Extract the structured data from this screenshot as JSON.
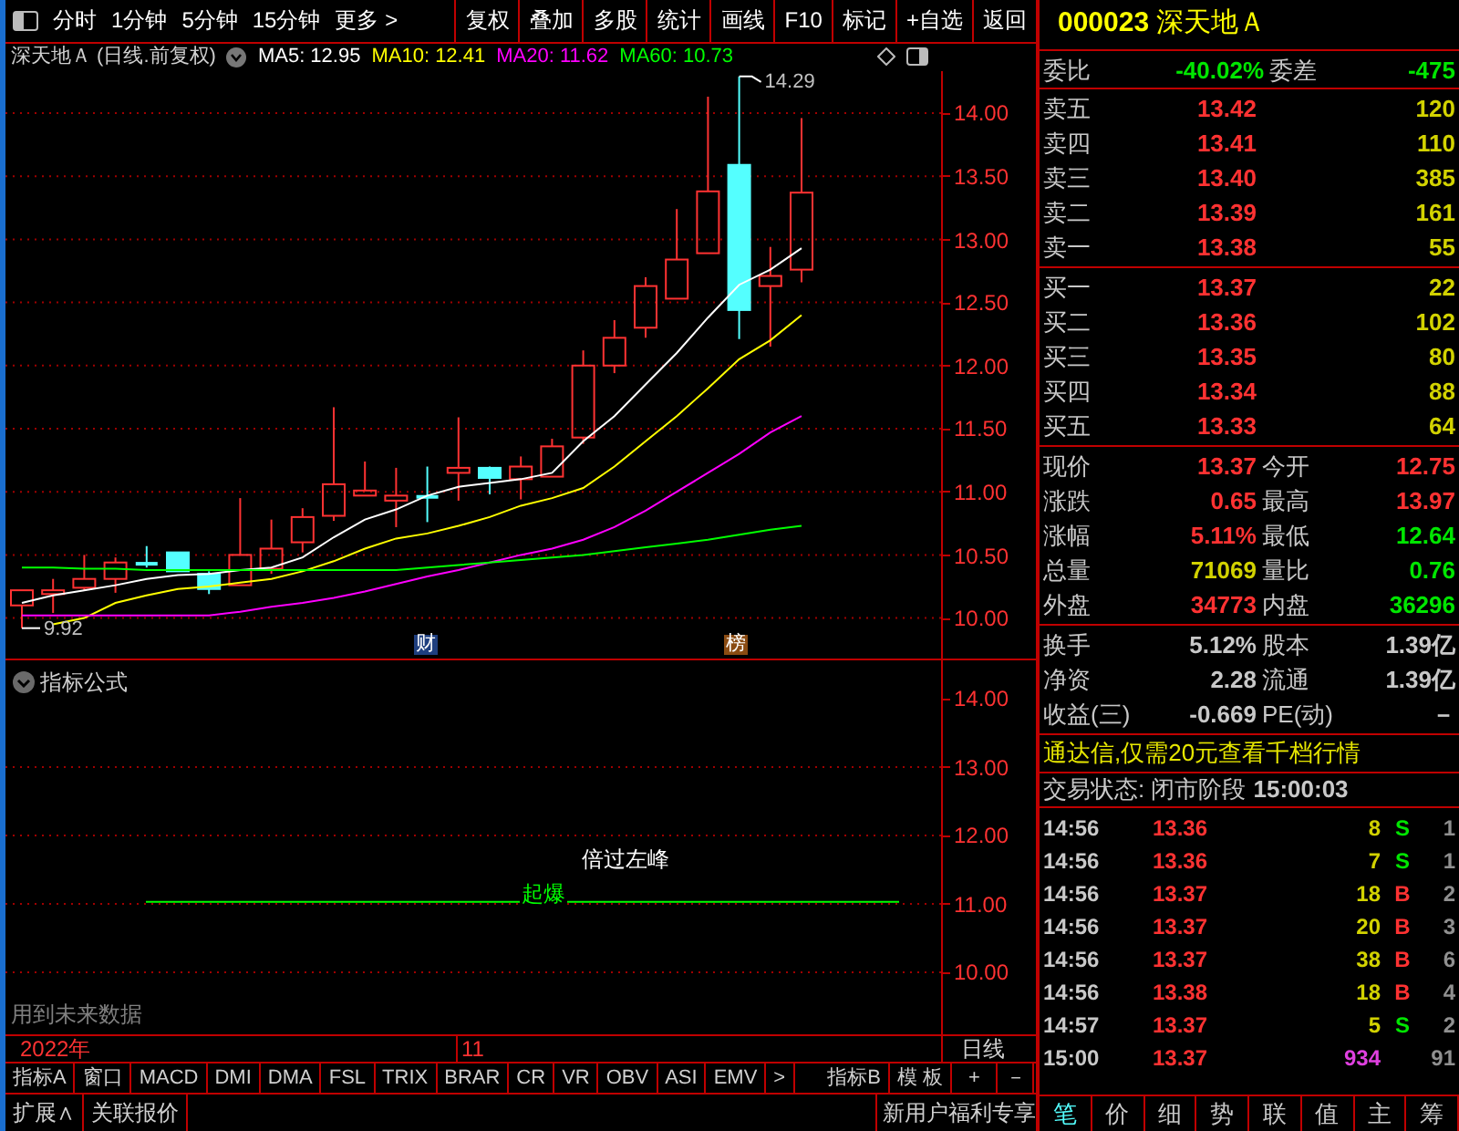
{
  "toolbar": {
    "periods": [
      "分时",
      "1分钟",
      "5分钟",
      "15分钟",
      "更多 >"
    ],
    "actions": [
      "复权",
      "叠加",
      "多股",
      "统计",
      "画线",
      "F10",
      "标记",
      "+自选",
      "返回"
    ]
  },
  "chart": {
    "title": "深天地Ａ (日线.前复权)",
    "ma": [
      {
        "label": "MA5: 12.95",
        "color": "#ffffff"
      },
      {
        "label": "MA10: 12.41",
        "color": "#ffff00"
      },
      {
        "label": "MA20: 11.62",
        "color": "#ff00ff"
      },
      {
        "label": "MA60: 10.73",
        "color": "#00ff00"
      }
    ],
    "price_axis": [
      "14.00",
      "13.50",
      "13.00",
      "12.50",
      "12.00",
      "11.50",
      "11.00",
      "10.50",
      "10.00"
    ],
    "high_label": "14.29",
    "low_label": "9.92",
    "events": [
      {
        "text": "财",
        "color": "#1f3f7f"
      },
      {
        "text": "榜",
        "color": "#8a4b12"
      }
    ]
  },
  "indicator": {
    "title": "指标公式",
    "axis": [
      "14.00",
      "13.00",
      "12.00",
      "11.00",
      "10.00"
    ],
    "signal_1": "倍过左峰",
    "signal_2": "起爆",
    "note": "用到未来数据"
  },
  "date_bar": {
    "year": "2022年",
    "month": "11",
    "period": "日线"
  },
  "indicator_tabs": [
    "指标A",
    "窗口",
    "MACD",
    "DMI",
    "DMA",
    "FSL",
    "TRIX",
    "BRAR",
    "CR",
    "VR",
    "OBV",
    "ASI",
    "EMV",
    ">",
    "指标B",
    "模 板",
    "+",
    "－"
  ],
  "bottom_bar": {
    "left": [
      "扩展∧",
      "关联报价"
    ],
    "right": "新用户福利专享"
  },
  "quote": {
    "code": "000023",
    "name": "深天地Ａ",
    "ratio": {
      "label": "委比",
      "value": "-40.02%",
      "label_2": "委差",
      "value_2": "-475"
    },
    "sell": [
      {
        "label": "卖五",
        "price": "13.42",
        "volume": "120"
      },
      {
        "label": "卖四",
        "price": "13.41",
        "volume": "110"
      },
      {
        "label": "卖三",
        "price": "13.40",
        "volume": "385"
      },
      {
        "label": "卖二",
        "price": "13.39",
        "volume": "161"
      },
      {
        "label": "卖一",
        "price": "13.38",
        "volume": "55"
      }
    ],
    "buy": [
      {
        "label": "买一",
        "price": "13.37",
        "volume": "22"
      },
      {
        "label": "买二",
        "price": "13.36",
        "volume": "102"
      },
      {
        "label": "买三",
        "price": "13.35",
        "volume": "80"
      },
      {
        "label": "买四",
        "price": "13.34",
        "volume": "88"
      },
      {
        "label": "买五",
        "price": "13.33",
        "volume": "64"
      }
    ],
    "stats": [
      {
        "label": "现价",
        "value": "13.37",
        "color": "#ff3232"
      },
      {
        "label": "今开",
        "value": "12.75",
        "color": "#ff3232"
      },
      {
        "label": "涨跌",
        "value": "0.65",
        "color": "#ff3232"
      },
      {
        "label": "最高",
        "value": "13.97",
        "color": "#ff3232"
      },
      {
        "label": "涨幅",
        "value": "5.11%",
        "color": "#ff3232"
      },
      {
        "label": "最低",
        "value": "12.64",
        "color": "#00e600"
      },
      {
        "label": "总量",
        "value": "71069",
        "color": "#d2d200"
      },
      {
        "label": "量比",
        "value": "0.76",
        "color": "#00e600"
      },
      {
        "label": "外盘",
        "value": "34773",
        "color": "#ff3232"
      },
      {
        "label": "内盘",
        "value": "36296",
        "color": "#00e600"
      }
    ],
    "finance": [
      {
        "label": "换手",
        "value": "5.12%"
      },
      {
        "label": "股本",
        "value": "1.39亿"
      },
      {
        "label": "净资",
        "value": "2.28"
      },
      {
        "label": "流通",
        "value": "1.39亿"
      },
      {
        "label": "收益(三)",
        "value": "-0.669"
      },
      {
        "label": "PE(动)",
        "value": "－"
      }
    ],
    "promo": "通达信,仅需20元查看千档行情",
    "status": {
      "label": "交易状态: 闭市阶段",
      "time": "15:00:03"
    },
    "ticks": [
      {
        "time": "14:56",
        "price": "13.36",
        "volume": "8",
        "side": "S",
        "kind": "sell",
        "count": "1"
      },
      {
        "time": "14:56",
        "price": "13.36",
        "volume": "7",
        "side": "S",
        "kind": "sell",
        "count": "1"
      },
      {
        "time": "14:56",
        "price": "13.37",
        "volume": "18",
        "side": "B",
        "kind": "buy",
        "count": "2"
      },
      {
        "time": "14:56",
        "price": "13.37",
        "volume": "20",
        "side": "B",
        "kind": "buy",
        "count": "3"
      },
      {
        "time": "14:56",
        "price": "13.37",
        "volume": "38",
        "side": "B",
        "kind": "buy",
        "count": "6"
      },
      {
        "time": "14:56",
        "price": "13.38",
        "volume": "18",
        "side": "B",
        "kind": "buy",
        "count": "4"
      },
      {
        "time": "14:57",
        "price": "13.37",
        "volume": "5",
        "side": "S",
        "kind": "sell",
        "count": "2"
      },
      {
        "time": "15:00",
        "price": "13.37",
        "volume": "934",
        "kind": "auction",
        "count": "91"
      }
    ],
    "tabs": [
      {
        "label": "笔",
        "selected": true
      },
      {
        "label": "价",
        "selected": false
      },
      {
        "label": "细",
        "selected": false
      },
      {
        "label": "势",
        "selected": false
      },
      {
        "label": "联",
        "selected": false
      },
      {
        "label": "值",
        "selected": false
      },
      {
        "label": "主",
        "selected": false
      },
      {
        "label": "筹",
        "selected": false
      }
    ]
  }
}
